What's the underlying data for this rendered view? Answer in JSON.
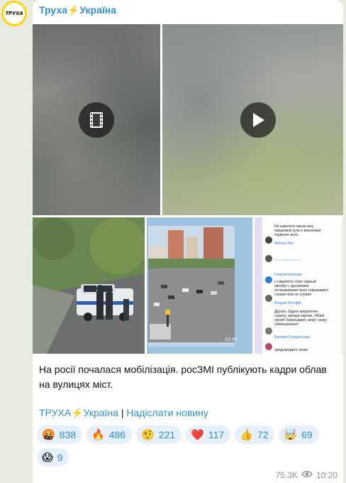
{
  "channel": {
    "name": "Труха⚡️Україна",
    "avatar_text": "ТРУХА"
  },
  "post": {
    "caption": "На росії почалася мобілізація. росЗМІ публікують кадри облав на вулицях міст.",
    "links": {
      "channel_link": "ТРУХА⚡️Україна",
      "separator": "|",
      "submit_link": "Надіслати новину"
    },
    "media": {
      "video1_icon": "film-icon",
      "video2_icon": "play-icon",
      "photo2_badge": "12:00",
      "photo3_messages": [
        {
          "name": "Aleksey Net",
          "text": "На самолете маски шоу ганшников куча и военкомат тормозит всех."
        },
        {
          "name": "Георгий Каленин",
          "text": "у самолёта стоит чёрный автобус с дрсниками останавливает всех спрашивают служил или не служил"
        },
        {
          "name": "Владия Котофф",
          "text": "Друзья, будьте аккуратнее, страла, приора чарная, УАЗик синий! Записывают, везут сразу облвоенкомат!"
        },
        {
          "name": "Евгения Кондратьева",
          "text": "предупредите своих"
        }
      ]
    },
    "reactions": [
      {
        "emoji": "🤬",
        "count": "838"
      },
      {
        "emoji": "🔥",
        "count": "486"
      },
      {
        "emoji": "🤨",
        "count": "221"
      },
      {
        "emoji": "❤️",
        "count": "117"
      },
      {
        "emoji": "👍",
        "count": "72"
      },
      {
        "emoji": "🤯",
        "count": "69"
      },
      {
        "emoji": "😱",
        "count": "9"
      }
    ],
    "views": "75.3K",
    "time": "10:20"
  },
  "colors": {
    "link": "#2f8fd0",
    "reaction_bg": "#e6f0fa",
    "page_bg": "#e7ebe0",
    "avatar_ring": "#ffd400"
  }
}
